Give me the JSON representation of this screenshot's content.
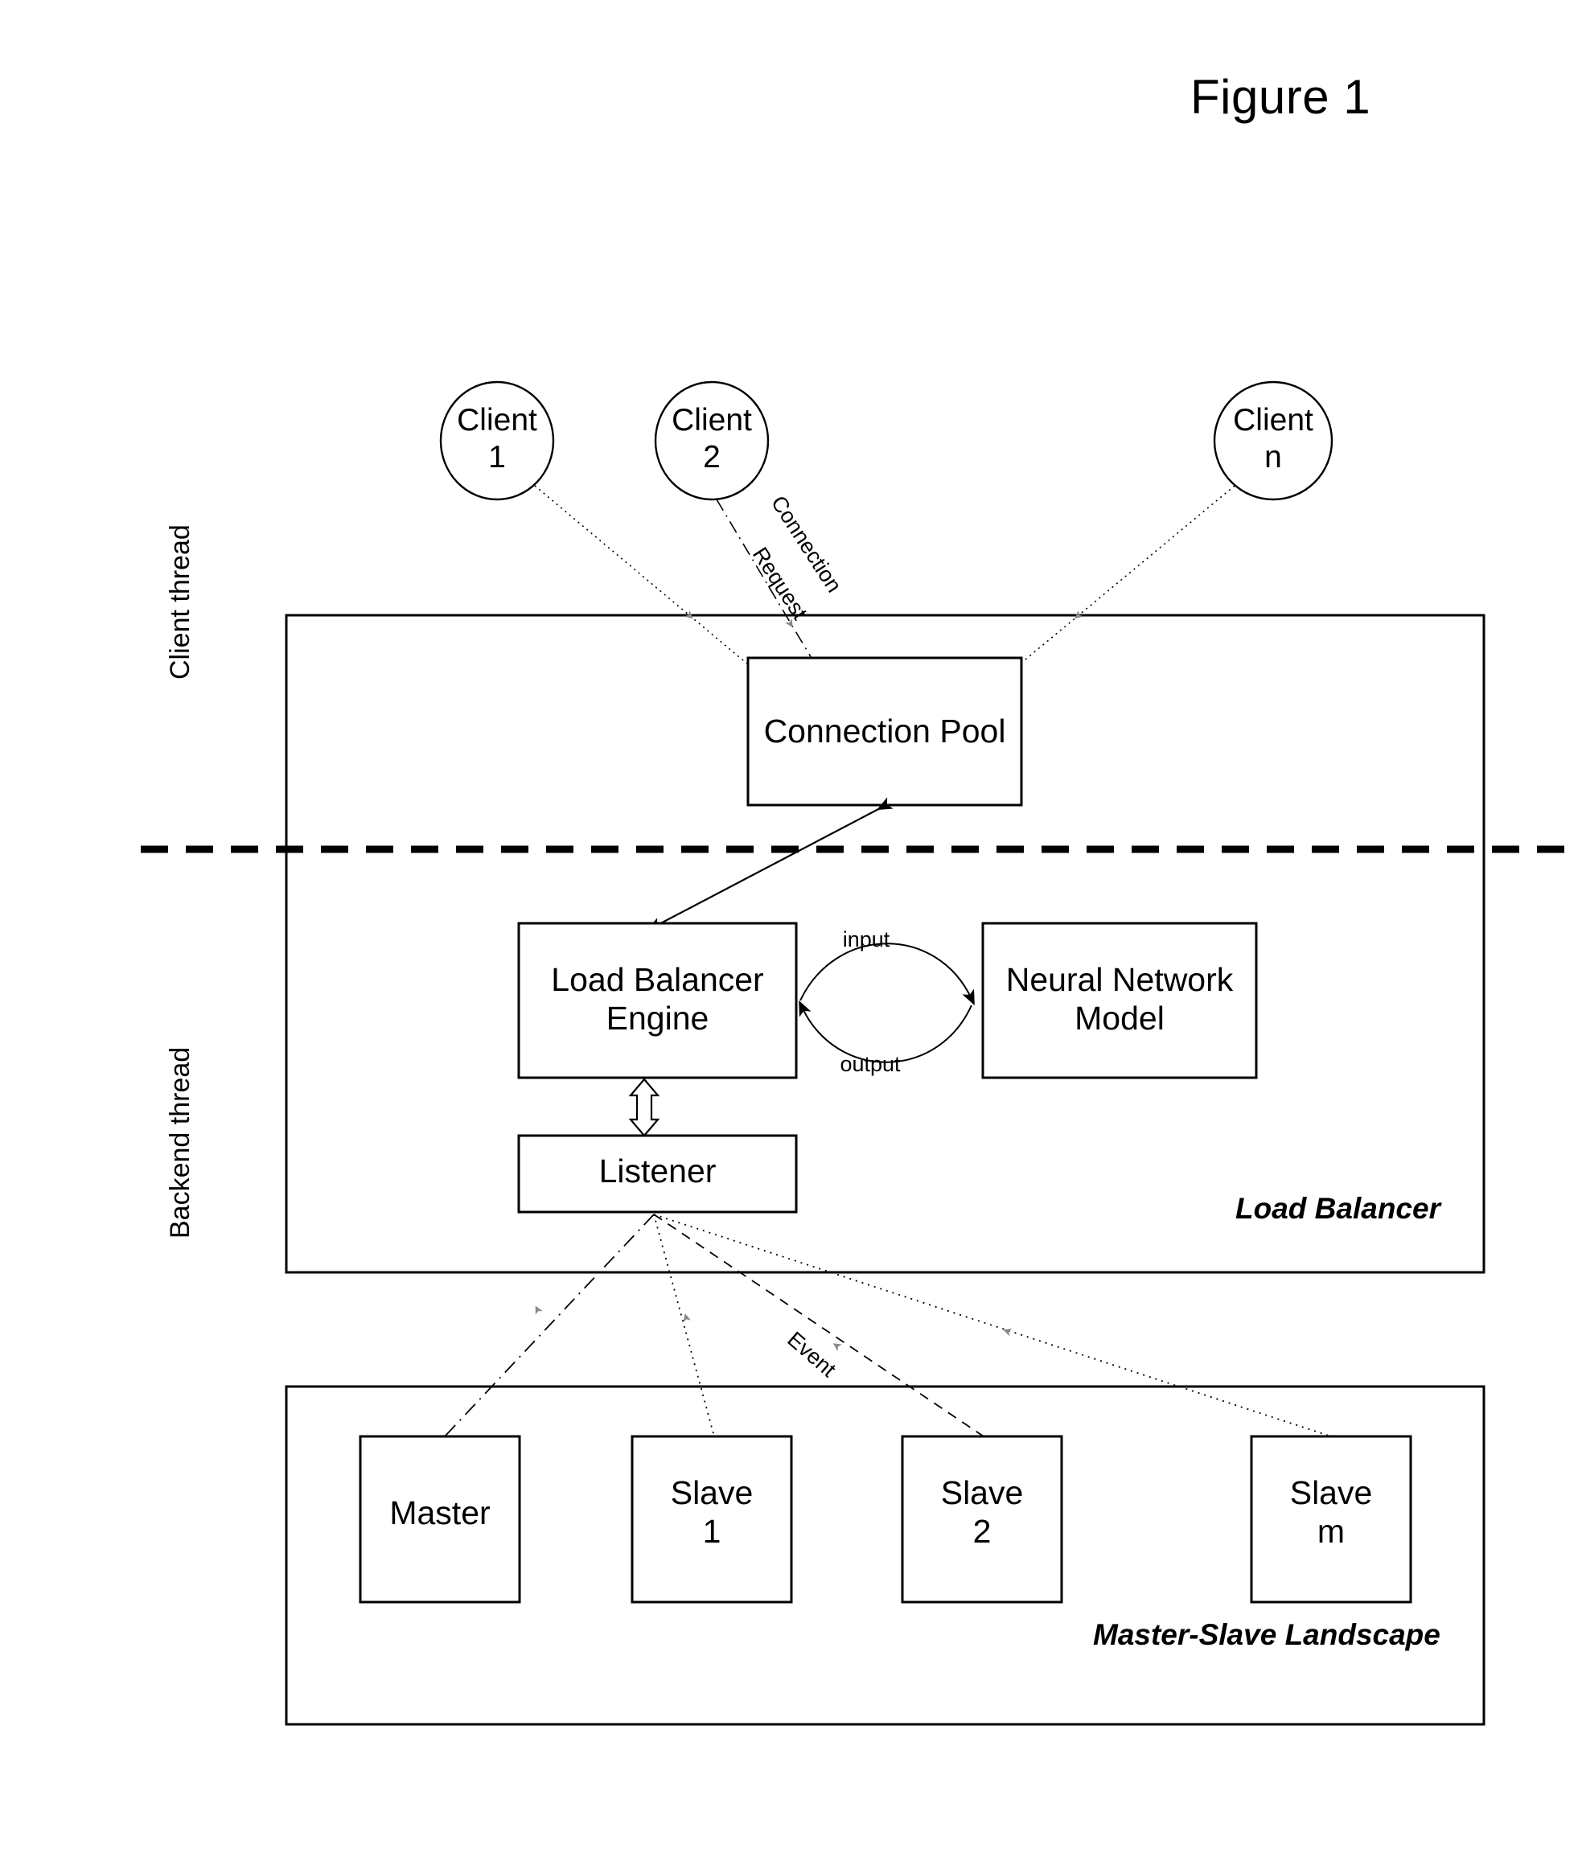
{
  "figure": {
    "title": "Figure 1"
  },
  "swimlanes": [
    {
      "label": "Client thread"
    },
    {
      "label": "Backend thread"
    }
  ],
  "clients": [
    {
      "label": "Client\n1"
    },
    {
      "label": "Client\n2"
    },
    {
      "label": "Client\nn"
    }
  ],
  "regions": [
    {
      "label": "Load Balancer"
    },
    {
      "label": "Master-Slave Landscape"
    }
  ],
  "nodes": {
    "connection_pool": "Connection Pool",
    "load_balancer_engine": "Load Balancer\nEngine",
    "neural_network_model": "Neural Network\nModel",
    "listener": "Listener"
  },
  "backend_nodes": [
    {
      "label": "Master"
    },
    {
      "label": "Slave\n1"
    },
    {
      "label": "Slave\n2"
    },
    {
      "label": "Slave\nm"
    }
  ],
  "edge_labels": {
    "connection_request": "Connection\nRequest",
    "input": "input",
    "output": "output",
    "event": "Event"
  },
  "colors": {
    "stroke": "#000000",
    "arrow_gray": "#808080",
    "background": "#ffffff"
  }
}
